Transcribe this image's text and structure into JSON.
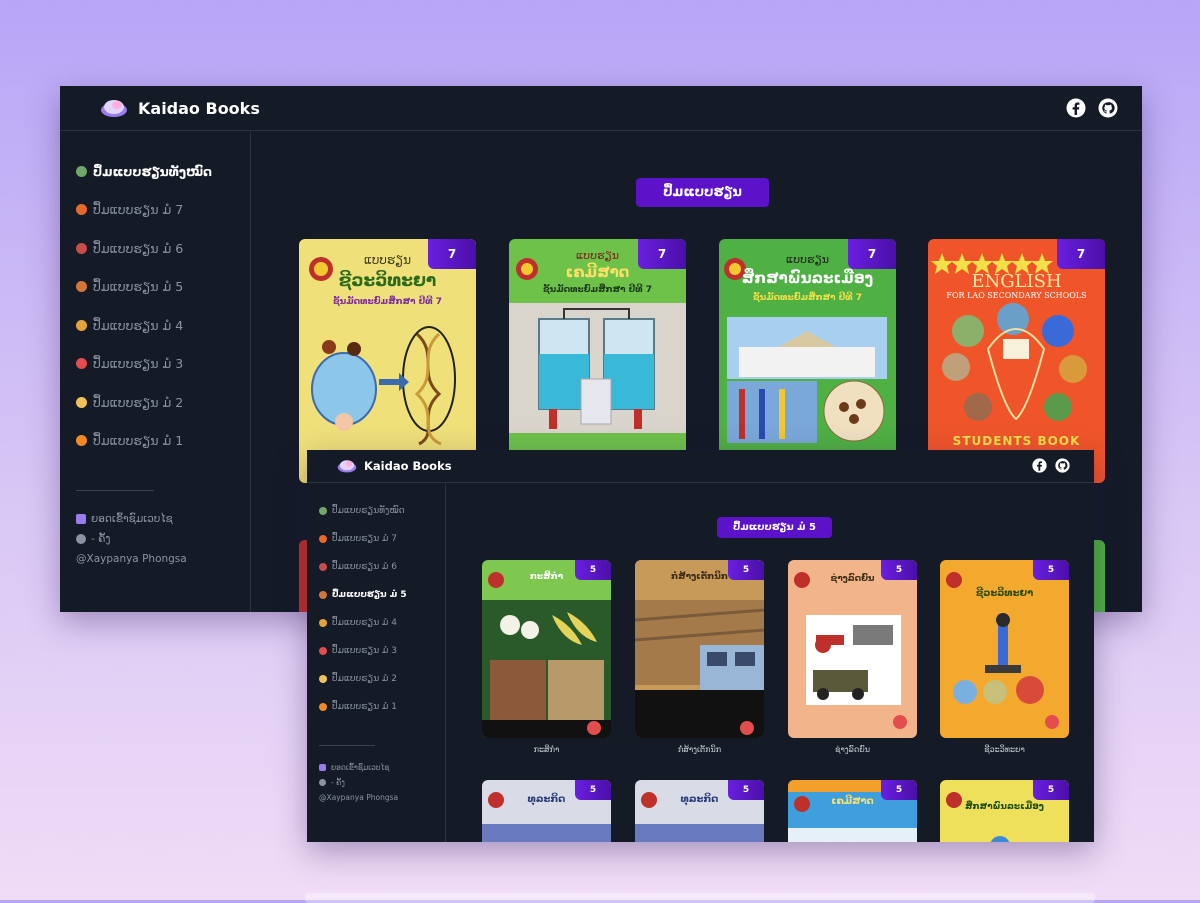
{
  "app": {
    "brand": "Kaidao Books"
  },
  "nav": {
    "items": [
      {
        "label": "ປຶ້ມແບບຮຽນທັງໝົດ",
        "icon": "books-icon",
        "color": "#6fa86a"
      },
      {
        "label": "ປຶ້ມແບບຮຽນ ມໍ 7",
        "icon": "pumpkin-icon",
        "color": "#e8682a"
      },
      {
        "label": "ປຶ້ມແບບຮຽນ ມໍ 6",
        "icon": "meat-icon",
        "color": "#c94c4c"
      },
      {
        "label": "ປຶ້ມແບບຮຽນ ມໍ 5",
        "icon": "drumstick-icon",
        "color": "#d3763a"
      },
      {
        "label": "ປຶ້ມແບບຮຽນ ມໍ 4",
        "icon": "burger-icon",
        "color": "#e3a53b"
      },
      {
        "label": "ປຶ້ມແບບຮຽນ ມໍ 3",
        "icon": "ball-icon",
        "color": "#e44d4d"
      },
      {
        "label": "ປຶ້ມແບບຮຽນ ມໍ 2",
        "icon": "cake-icon",
        "color": "#f0c25a"
      },
      {
        "label": "ປຶ້ມແບບຮຽນ ມໍ 1",
        "icon": "orange-icon",
        "color": "#f08a24"
      }
    ],
    "footer": {
      "visits": "ຍອດເຂົ້າຊົມເວບໄຊ",
      "count": "- ຄັ້ງ",
      "author": "@Xaypanya Phongsa"
    }
  },
  "window1": {
    "heading": "ປຶ້ມແບບຮຽນ",
    "active_nav": 0,
    "books": [
      {
        "badge": "7",
        "title": "ຊີວະວິທະຍາ",
        "series": "ແບບຮຽນ",
        "subtitle": "ຊັ້ນມັດທະຍົມສຶກສາ ປີທີ 7",
        "bg": "#efe07a",
        "title_color": "#2a6a1a"
      },
      {
        "badge": "7",
        "title": "ເຄມີສາດ",
        "series": "ແບບຮຽນ",
        "subtitle": "ຊັ້ນມັດທະຍົມສຶກສາ ປີທີ 7",
        "bg": "#6ec24a",
        "title_color": "#ffe066"
      },
      {
        "badge": "7",
        "title": "ສຶກສາພົນລະເມືອງ",
        "series": "ແບບຮຽນ",
        "subtitle": "ຊັ້ນມັດທະຍົມສຶກສາ ປີທີ 7",
        "bg": "#4fb043",
        "title_color": "#ffffff"
      },
      {
        "badge": "7",
        "title": "ENGLISH",
        "series": "FOR LAO SECONDARY SCHOOLS",
        "subtitle": "STUDENTS BOOK",
        "bg": "#f0552a",
        "title_color": "#ffe7a6"
      }
    ]
  },
  "window2": {
    "heading": "ປຶ້ມແບບຮຽນ ມໍ 5",
    "active_nav": 3,
    "books": [
      {
        "badge": "5",
        "title": "ກະສິກຳ",
        "caption": "ກະສິກຳ",
        "bg": "#7ec850",
        "title_color": "#ffffff"
      },
      {
        "badge": "5",
        "title": "ກໍ່ສ້າງເຕັກນິກ",
        "caption": "ກໍ່ສ້າງເຕັກນິກ",
        "bg": "#c79a5a",
        "title_color": "#3a2a10"
      },
      {
        "badge": "5",
        "title": "ຊ່າງລົດຍົນ",
        "caption": "ຊ່າງລົດຍົນ",
        "bg": "#f2b48a",
        "title_color": "#3a2a10"
      },
      {
        "badge": "5",
        "title": "ຊີວະວິທະຍາ",
        "caption": "ຊີວະວິທະຍາ",
        "bg": "#f3a92e",
        "title_color": "#2a4a10"
      },
      {
        "badge": "5",
        "title": "ທຸລະກິດ",
        "caption": "",
        "bg": "#d9dbe6",
        "title_color": "#2a3a7a"
      },
      {
        "badge": "5",
        "title": "ທຸລະກິດ",
        "caption": "",
        "bg": "#d9dbe6",
        "title_color": "#2a3a7a"
      },
      {
        "badge": "5",
        "title": "ເຄມີສາດ",
        "caption": "",
        "bg": "#3f9fdc",
        "title_color": "#ffe066"
      },
      {
        "badge": "5",
        "title": "ສຶກສາພົນລະເມືອງ",
        "caption": "",
        "bg": "#eee05a",
        "title_color": "#1a4a10"
      }
    ]
  }
}
